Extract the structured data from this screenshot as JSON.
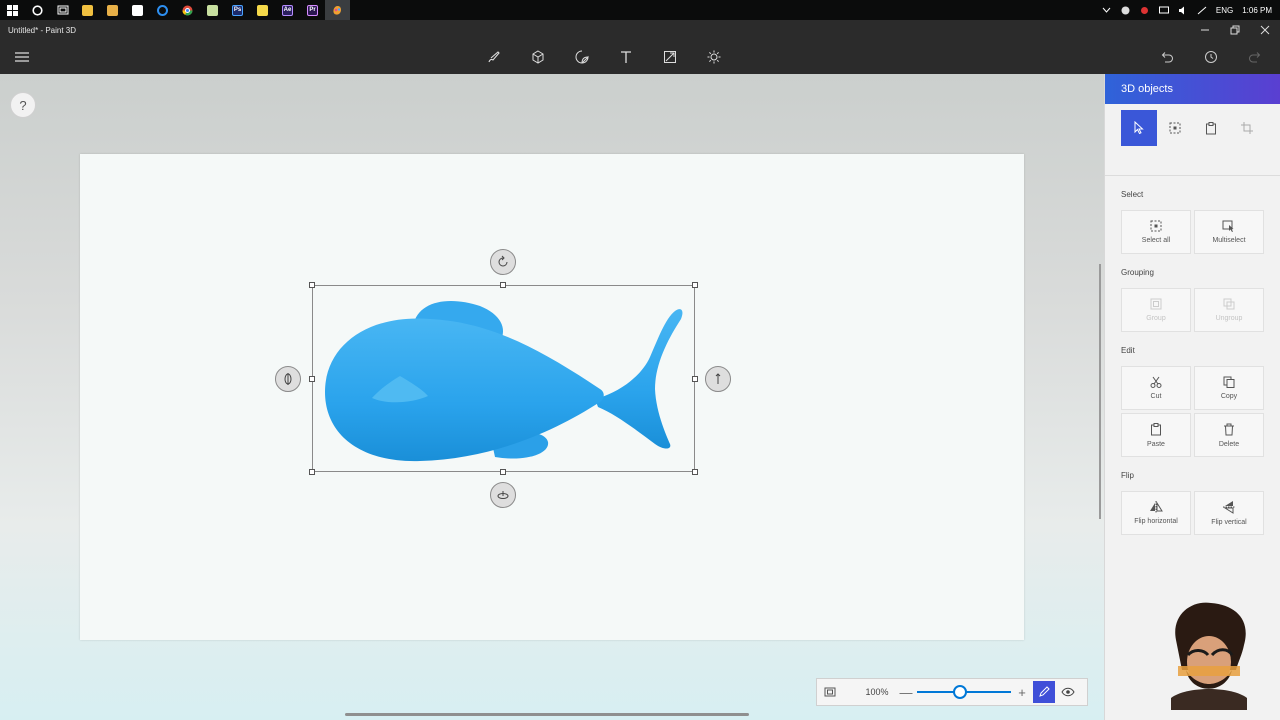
{
  "taskbar": {
    "apps": [
      {
        "icon": "windows-start-icon"
      },
      {
        "icon": "cortana-icon"
      },
      {
        "icon": "task-view-icon"
      },
      {
        "icon": "file-explorer-icon"
      },
      {
        "icon": "photos-icon"
      },
      {
        "icon": "store-icon"
      },
      {
        "icon": "edge-icon"
      },
      {
        "icon": "chrome-icon"
      },
      {
        "icon": "notepad-icon"
      },
      {
        "icon": "photoshop-icon",
        "label": "Ps"
      },
      {
        "icon": "sticky-notes-icon"
      },
      {
        "icon": "after-effects-icon",
        "label": "Ae"
      },
      {
        "icon": "premiere-icon",
        "label": "Pr"
      },
      {
        "icon": "paint3d-icon"
      }
    ],
    "language": "ENG",
    "time": "1:06 PM"
  },
  "window": {
    "title": "Untitled* - Paint 3D"
  },
  "toolbar": {
    "tools": [
      "brushes-icon",
      "3d-shapes-icon",
      "stickers-icon",
      "text-icon",
      "effects-icon",
      "canvas-icon",
      "lighting-icon"
    ],
    "history": [
      "undo-icon",
      "history-icon",
      "redo-icon"
    ]
  },
  "help": {
    "label": "?"
  },
  "zoom": {
    "value": "100%",
    "minus": "—",
    "plus": "+",
    "level": 0.45
  },
  "panel": {
    "title": "3D objects",
    "sections": {
      "select": {
        "title": "Select",
        "buttons": [
          "Select all",
          "Multiselect"
        ]
      },
      "grouping": {
        "title": "Grouping",
        "buttons": [
          "Group",
          "Ungroup"
        ]
      },
      "edit": {
        "title": "Edit",
        "buttons": [
          "Cut",
          "Copy",
          "Paste",
          "Delete"
        ]
      },
      "flip": {
        "title": "Flip",
        "buttons": [
          "Flip horizontal",
          "Flip vertical"
        ]
      }
    }
  },
  "colors": {
    "fish": "#2aa3ec",
    "accent": "#3a57d8",
    "chrome": "#2b2b2b"
  }
}
